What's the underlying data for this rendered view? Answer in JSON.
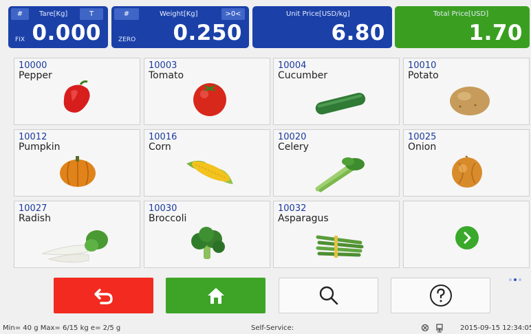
{
  "display": {
    "tare": {
      "hash": "#",
      "title": "Tare[Kg]",
      "flag": "T",
      "value": "0.000",
      "mode": "FIX"
    },
    "weight": {
      "hash": "#",
      "title": "Weight[Kg]",
      "flag": ">0<",
      "value": "0.250",
      "mode": "ZERO"
    },
    "unit_price": {
      "title": "Unit Price[USD/kg]",
      "value": "6.80"
    },
    "total_price": {
      "title": "Total Price[USD]",
      "value": "1.70"
    }
  },
  "products": [
    {
      "code": "10000",
      "name": "Pepper"
    },
    {
      "code": "10003",
      "name": "Tomato"
    },
    {
      "code": "10004",
      "name": "Cucumber"
    },
    {
      "code": "10010",
      "name": "Potato"
    },
    {
      "code": "10012",
      "name": "Pumpkin"
    },
    {
      "code": "10016",
      "name": "Corn"
    },
    {
      "code": "10020",
      "name": "Celery"
    },
    {
      "code": "10025",
      "name": "Onion"
    },
    {
      "code": "10027",
      "name": "Radish"
    },
    {
      "code": "10030",
      "name": "Broccoli"
    },
    {
      "code": "10032",
      "name": "Asparagus"
    }
  ],
  "pagination": {
    "pages": 3,
    "current": 2
  },
  "actions": [
    {
      "icon": "back-arrow-icon"
    },
    {
      "icon": "home-icon"
    },
    {
      "icon": "search-icon"
    },
    {
      "icon": "help-icon"
    }
  ],
  "status": {
    "range": "Min= 40 g  Max= 6/15 kg  e= 2/5 g",
    "mode": "Self-Service:",
    "datetime": "2015-09-15  12:34:05"
  },
  "colors": {
    "panel_blue": "#1b41a8",
    "panel_green": "#3a9f20",
    "back_red": "#f22a1f",
    "home_green": "#3ea428"
  }
}
